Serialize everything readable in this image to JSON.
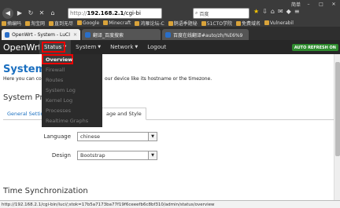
{
  "browser": {
    "window_label": "简单",
    "url": {
      "proto": "http://",
      "host": "192.168.2.1",
      "path": "/cgi-bi"
    },
    "search_placeholder": "百度",
    "bookmarks": [
      "摘编吗",
      "淘宝网",
      "直到无尽",
      "Google",
      "Minecraft",
      "鸿雁论坛-C",
      "鹅语季题秘",
      "51CTO学院",
      "免费域名",
      "Vulnerabil"
    ]
  },
  "tabs": [
    {
      "label": "OpenWrt - System - LuCI",
      "active": true
    },
    {
      "label": "翻译_百度搜索",
      "active": false
    },
    {
      "label": "百度在线翻译#auto/zh/%E6%9",
      "active": false
    }
  ],
  "header": {
    "brand": "OpenWrt",
    "menu": [
      "Status",
      "System",
      "Network",
      "Logout"
    ],
    "autorefresh": "AUTO REFRESH ON"
  },
  "status_menu": {
    "items": [
      "Overview",
      "Firewall",
      "Routes",
      "System Log",
      "Kernel Log",
      "Processes",
      "Realtime Graphs"
    ]
  },
  "page": {
    "title": "System",
    "desc_left": "Here you can co",
    "desc_right": "our device like its hostname or the timezone.",
    "section": "System Pro",
    "subtabs": [
      "General Settin",
      "age and Style"
    ],
    "language_label": "Language",
    "language_value": "chinese",
    "design_label": "Design",
    "design_value": "Bootstrap",
    "time_sync": "Time Synchronization"
  },
  "statusbar": "http://192.168.2.1/cgi-bin/luci/;stok=17b5a7173ba77f19f6ceeefb6c8bf310/admin/status/overview"
}
